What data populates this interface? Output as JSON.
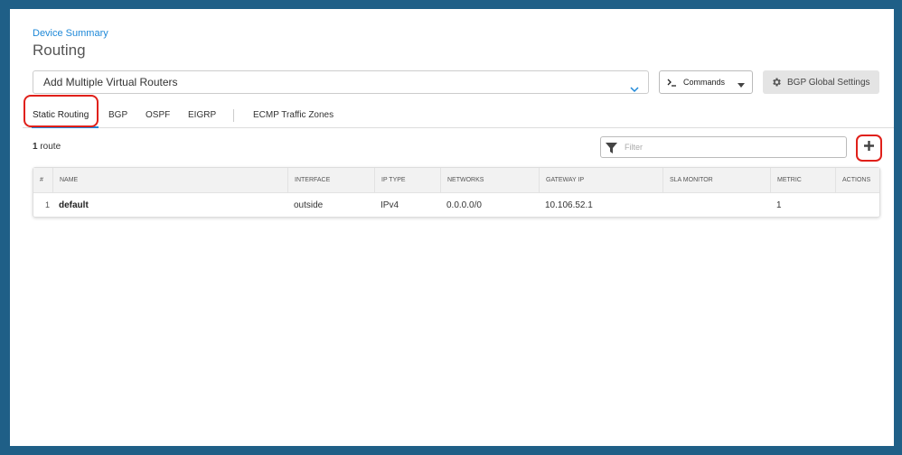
{
  "breadcrumb": "Device Summary",
  "page_title": "Routing",
  "virtual_router_select": {
    "value": "Add Multiple Virtual Routers"
  },
  "commands_button": {
    "label": "Commands"
  },
  "bgp_global_button": {
    "label": "BGP Global Settings"
  },
  "tabs": [
    {
      "label": "Static Routing",
      "active": true
    },
    {
      "label": "BGP",
      "active": false
    },
    {
      "label": "OSPF",
      "active": false
    },
    {
      "label": "EIGRP",
      "active": false
    },
    {
      "label": "ECMP Traffic Zones",
      "active": false
    }
  ],
  "route_summary": {
    "count": "1",
    "unit": "route"
  },
  "filter": {
    "placeholder": "Filter",
    "value": ""
  },
  "table": {
    "columns": [
      "#",
      "NAME",
      "INTERFACE",
      "IP TYPE",
      "NETWORKS",
      "GATEWAY IP",
      "SLA MONITOR",
      "METRIC",
      "ACTIONS"
    ],
    "rows": [
      {
        "index": "1",
        "name": "default",
        "interface": "outside",
        "ip_type": "IPv4",
        "networks": "0.0.0.0/0",
        "gateway_ip": "10.106.52.1",
        "sla_monitor": "",
        "metric": "1",
        "actions": ""
      }
    ]
  },
  "colors": {
    "accent": "#1e88d8",
    "highlight": "#e0201a",
    "outer_border": "#1f5f87"
  },
  "icons": {
    "vr_select": "chevron-down-icon",
    "commands": "terminal-icon",
    "commands_caret": "caret-down-icon",
    "bgp_global": "gear-icon",
    "filter": "filter-icon",
    "add": "plus-icon"
  }
}
